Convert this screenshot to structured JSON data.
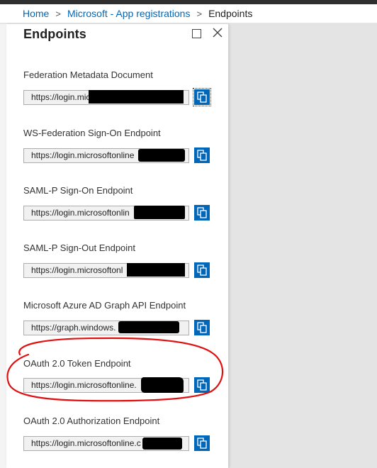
{
  "breadcrumb": {
    "home": "Home",
    "app_registrations": "Microsoft - App registrations",
    "current": "Endpoints",
    "separator": ">"
  },
  "blade": {
    "title": "Endpoints"
  },
  "endpoints": [
    {
      "label": "Federation Metadata Document",
      "value": "https://login.mic"
    },
    {
      "label": "WS-Federation Sign-On Endpoint",
      "value": "https://login.microsoftonline"
    },
    {
      "label": "SAML-P Sign-On Endpoint",
      "value": "https://login.microsoftonlin"
    },
    {
      "label": "SAML-P Sign-Out Endpoint",
      "value": "https://login.microsoftonl"
    },
    {
      "label": "Microsoft Azure AD Graph API Endpoint",
      "value": "https://graph.windows."
    },
    {
      "label": "OAuth 2.0 Token Endpoint",
      "value": "https://login.microsoftonline."
    },
    {
      "label": "OAuth 2.0 Authorization Endpoint",
      "value": "https://login.microsoftonline.c"
    }
  ],
  "icons": {
    "copy": "copy-icon",
    "close": "close-icon",
    "maximize": "maximize-icon",
    "breadcrumb_separator": "chevron-right-icon"
  },
  "colors": {
    "accent": "#0067b8",
    "annotation": "#e01010",
    "redaction": "#000000"
  }
}
